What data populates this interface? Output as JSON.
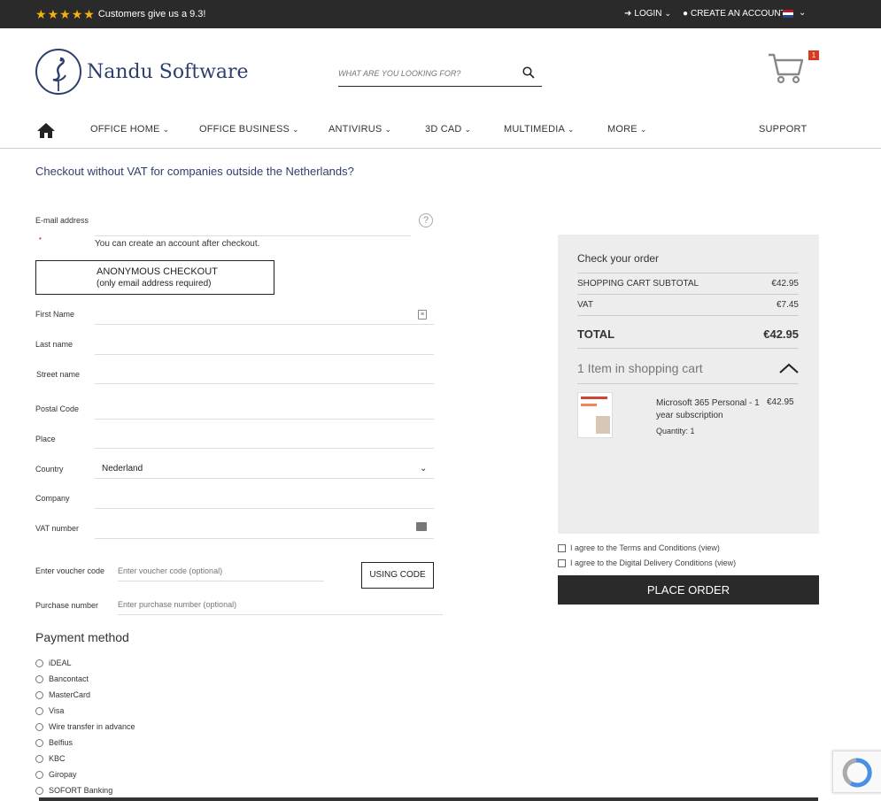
{
  "topbar": {
    "rating_text": "Customers give us a 9.3!",
    "login_label": "LOGIN",
    "create_account_label": "CREATE AN ACCOUNT",
    "stars": 5
  },
  "header": {
    "brand": "Nandu Software",
    "search_placeholder": "WHAT ARE YOU LOOKING FOR?",
    "cart_count": "1"
  },
  "nav": {
    "items": [
      {
        "label": "OFFICE HOME"
      },
      {
        "label": "OFFICE BUSINESS"
      },
      {
        "label": "ANTIVIRUS"
      },
      {
        "label": "3D CAD"
      },
      {
        "label": "MULTIMEDIA"
      },
      {
        "label": "MORE"
      }
    ],
    "support_label": "SUPPORT"
  },
  "checkout": {
    "vat_link": "Checkout without VAT for companies outside the Netherlands?",
    "email_label": "E-mail address",
    "account_note": "You can create an account after checkout.",
    "anon_title": "ANONYMOUS CHECKOUT",
    "anon_sub": "(only email address required)",
    "first_name_label": "First Name",
    "last_name_label": "Last name",
    "street_label": "Street name",
    "postal_label": "Postal Code",
    "place_label": "Place",
    "country_label": "Country",
    "country_value": "Nederland",
    "company_label": "Company",
    "vat_label": "VAT number",
    "voucher_label": "Enter voucher code",
    "voucher_placeholder": "Enter voucher code (optional)",
    "using_code_label": "USING CODE",
    "purchase_label": "Purchase number",
    "purchase_placeholder": "Enter purchase number (optional)"
  },
  "payment": {
    "title": "Payment method",
    "options": [
      "iDEAL",
      "Bancontact",
      "MasterCard",
      "Visa",
      "Wire transfer in advance",
      "Belfius",
      "KBC",
      "Giropay",
      "SOFORT Banking"
    ]
  },
  "summary": {
    "title": "Check your order",
    "subtotal_label": "SHOPPING CART SUBTOTAL",
    "subtotal_value": "€42.95",
    "vat_label": "VAT",
    "vat_value": "€7.45",
    "total_label": "TOTAL",
    "total_value": "€42.95",
    "items_title": "1 Item in shopping cart",
    "product_name": "Microsoft 365 Personal - 1 year subscription",
    "product_price": "€42.95",
    "product_qty": "Quantity: 1"
  },
  "agreements": {
    "terms": "I agree to the Terms and Conditions (view)",
    "delivery": "I agree to the Digital Delivery Conditions (view)"
  },
  "place_order_label": "PLACE ORDER",
  "colors": {
    "dark": "#2a2a2a",
    "brand": "#2d3f6b",
    "star": "#f6b20a",
    "badge": "#d9391c",
    "summary_bg": "#ededed"
  }
}
